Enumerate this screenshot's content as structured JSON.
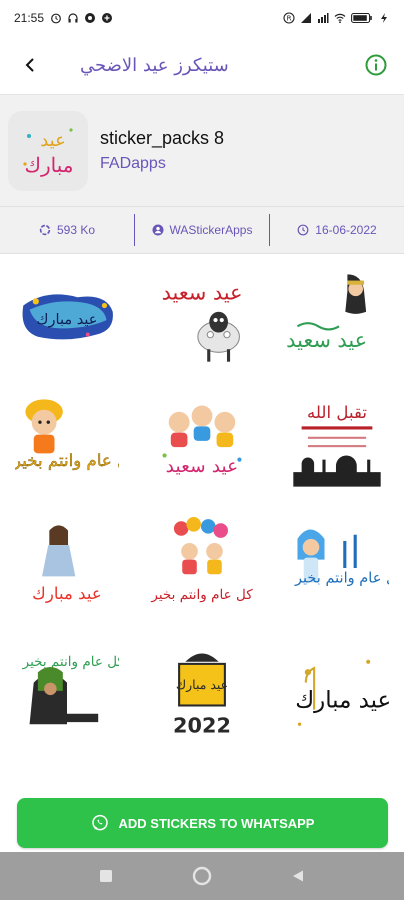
{
  "status_bar": {
    "time": "21:55",
    "battery_icon": "battery-icon",
    "wifi_icon": "wifi-icon",
    "signal_icon": "signal-icon"
  },
  "app_bar": {
    "title": "ستيكرز عيد الاضحي",
    "back_icon": "chevron-left-icon",
    "info_icon": "info-icon"
  },
  "pack": {
    "tray_text_top": "عيد",
    "tray_text_bottom": "مبارك",
    "name": "sticker_packs 8",
    "publisher": "FADapps"
  },
  "info": {
    "size": "593 Ko",
    "author": "WAStickerApps",
    "date": "16-06-2022"
  },
  "stickers": [
    {
      "kind": "text-badge",
      "text": "عيد مبارك"
    },
    {
      "kind": "sheep",
      "text": "عيد سعيد"
    },
    {
      "kind": "woman",
      "text": "عيد سعيد"
    },
    {
      "kind": "boy",
      "text": "كل عام وانتم بخير"
    },
    {
      "kind": "kids",
      "text": "عيد سعيد"
    },
    {
      "kind": "mosque",
      "text": "تقبل الله"
    },
    {
      "kind": "girl",
      "text": "عيد مبارك"
    },
    {
      "kind": "balloons",
      "text": "كل عام وانتم بخير"
    },
    {
      "kind": "blue-girl",
      "text": "كل عام وانتم بخير"
    },
    {
      "kind": "green-cloak",
      "text": "كل عام وانتم بخير"
    },
    {
      "kind": "year",
      "text": "عيد مبارك",
      "year": "2022"
    },
    {
      "kind": "calligraphy",
      "text": "عيد مبارك"
    }
  ],
  "add_button": {
    "label": "ADD STICKERS TO WHATSAPP",
    "icon": "whatsapp-icon",
    "color": "#2ec24a"
  },
  "accent_color": "#6a56b8"
}
